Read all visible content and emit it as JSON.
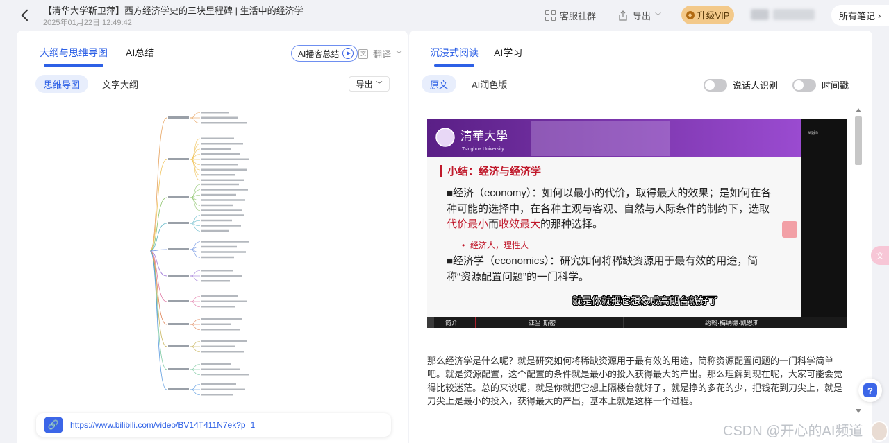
{
  "header": {
    "title": "【清华大学靳卫萍】西方经济学史的三块里程碑 | 生活中的经济学",
    "date": "2025年01月22日 12:49:42",
    "service_label": "客服社群",
    "export_label": "导出",
    "vip_label": "升级VIP",
    "all_notes_label": "所有笔记"
  },
  "left": {
    "tabs": [
      "大纲与思维导图",
      "AI总结"
    ],
    "podcast_label": "AI播客总结",
    "translate_label": "翻译",
    "view_chips": [
      "思维导图",
      "文字大纲"
    ],
    "export_label": "导出",
    "link_url": "https://www.bilibili.com/video/BV14T411N7ek?p=1"
  },
  "right": {
    "tabs": [
      "沉浸式阅读",
      "AI学习"
    ],
    "mode_chips": [
      "原文",
      "AI润色版"
    ],
    "toggles": [
      "说话人识别",
      "时间戳"
    ],
    "slide": {
      "university": "清華大學",
      "university_en": "Tsinghua University",
      "heading": "小结：经济与经济学",
      "p1_pre": "■经济（economy）：如何以最小的代价，取得最大的效果；是如何在各种可能的选择中，在各种主观与客观、自然与人际条件的制约下，选取",
      "p1_red1": "代价最小",
      "p1_mid": "而",
      "p1_red2": "收效最大",
      "p1_post": "的那种选择。",
      "bullet": "经济人，理性人",
      "p2": "■经济学（economics）：研究如何将稀缺资源用于最有效的用途，简称“资源配置问题”的一门科学。",
      "subtitle": "就是你就把它想象成高朗台就好了",
      "webcam_name": "wpjin",
      "timeline": [
        "简介",
        "亚当·斯密",
        "约翰·梅纳德·凯恩斯"
      ]
    },
    "paragraph": "那么经济学是什么呢？就是研究如何将稀缺资源用于最有效的用途，简称资源配置问题的一门科学简单吧。就是资源配置，这个配置的条件就是最小的投入获得最大的产出。那么理解到现在呢，大家可能会觉得比较迷茫。总的来说呢，就是你就把它想上隔楼台就好了，就是挣的多花的少，把钱花到刀尖上，就是刀尖上是最小的投入，获得最大的产出，基本上就是这样一个过程。"
  },
  "watermark": "CSDN @开心的AI频道",
  "colors": {
    "accent": "#2d60e6",
    "vip": "#f3c98a",
    "slide_purple": "#6a2a9a",
    "slide_red": "#c0182a"
  }
}
